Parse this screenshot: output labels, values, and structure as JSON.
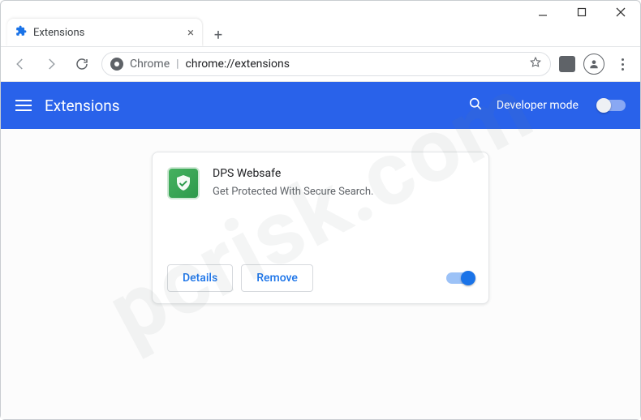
{
  "window": {
    "tab": {
      "title": "Extensions"
    }
  },
  "omnibox": {
    "prefix": "Chrome",
    "separator": "|",
    "url": "chrome://extensions"
  },
  "header": {
    "title": "Extensions",
    "developer_mode_label": "Developer mode",
    "developer_mode_on": false
  },
  "extension": {
    "name": "DPS Websafe",
    "description": "Get Protected With Secure Search.",
    "details_label": "Details",
    "remove_label": "Remove",
    "enabled": true
  },
  "watermark": "pcrisk.com"
}
